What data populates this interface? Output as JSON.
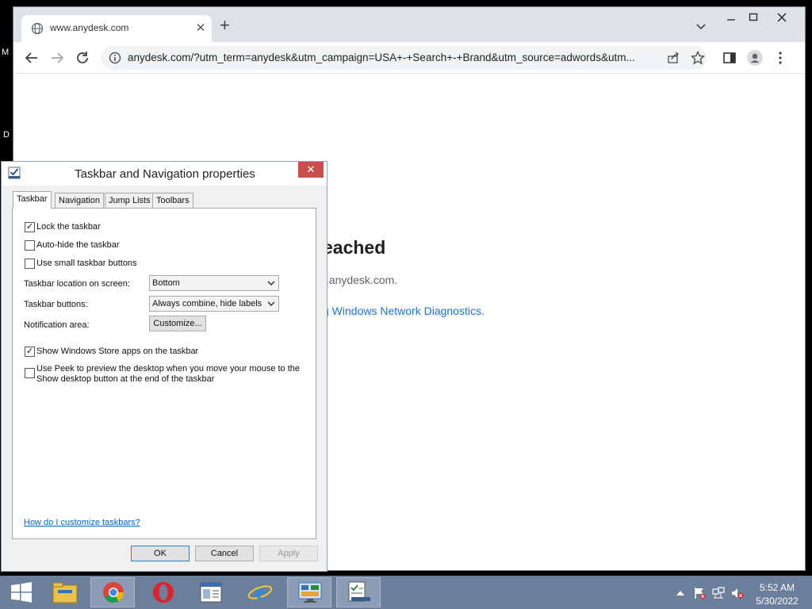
{
  "desktop": {
    "edge_text_1": "M",
    "edge_text_2": "D"
  },
  "browser": {
    "tab_title": "www.anydesk.com",
    "new_tab_label": "+",
    "url": "anydesk.com/?utm_term=anydesk&utm_campaign=USA+-+Search+-+Brand&utm_source=adwords&utm...",
    "error_heading": "eached",
    "error_host": "/.anydesk.com.",
    "error_diag": "g Windows Network Diagnostics."
  },
  "dialog": {
    "title": "Taskbar and Navigation properties",
    "close_glyph": "✕",
    "tabs": [
      {
        "label": "Taskbar",
        "active": true
      },
      {
        "label": "Navigation",
        "active": false
      },
      {
        "label": "Jump Lists",
        "active": false
      },
      {
        "label": "Toolbars",
        "active": false
      }
    ],
    "checkboxes": {
      "lock": {
        "label": "Lock the taskbar",
        "checked": true
      },
      "autohide": {
        "label": "Auto-hide the taskbar",
        "checked": false
      },
      "small": {
        "label": "Use small taskbar buttons",
        "checked": false
      },
      "store": {
        "label": "Show Windows Store apps on the taskbar",
        "checked": true
      },
      "peek": {
        "label_line1": "Use Peek to preview the desktop when you move your mouse to the",
        "label_line2": "Show desktop button at the end of the taskbar",
        "checked": false
      }
    },
    "location_label": "Taskbar location on screen:",
    "location_value": "Bottom",
    "buttons_label": "Taskbar buttons:",
    "buttons_value": "Always combine, hide labels",
    "notification_label": "Notification area:",
    "customize_label": "Customize...",
    "help_link": "How do I customize taskbars?",
    "ok_label": "OK",
    "cancel_label": "Cancel",
    "apply_label": "Apply"
  },
  "taskbar": {
    "apps": [
      {
        "name": "start-button",
        "icon": "windows-logo-icon"
      },
      {
        "name": "file-explorer",
        "icon": "folder-icon"
      },
      {
        "name": "chrome",
        "icon": "chrome-icon"
      },
      {
        "name": "opera",
        "icon": "opera-icon"
      },
      {
        "name": "server-manager",
        "icon": "server-icon"
      },
      {
        "name": "internet-explorer",
        "icon": "ie-icon"
      },
      {
        "name": "control-panel",
        "icon": "control-panel-icon"
      },
      {
        "name": "taskbar-properties",
        "icon": "taskbar-properties-icon"
      }
    ],
    "time": "5:52 AM",
    "date": "5/30/2022"
  },
  "colors": {
    "taskbar": "#6b7f9a",
    "dialog_close": "#c7504a",
    "link": "#0066cc",
    "chrome_link": "#1a73e8"
  }
}
